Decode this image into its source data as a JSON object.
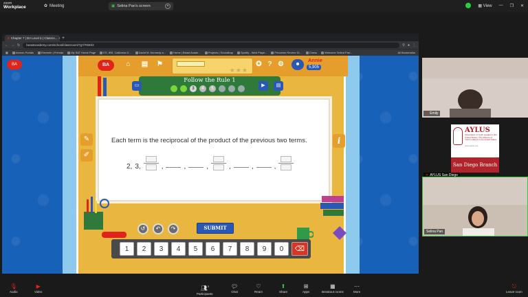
{
  "zoom": {
    "app_name": "zoom",
    "app_sub": "Workplace",
    "meeting_label": "Meeting",
    "share_label": "Selina Pan's screen",
    "view_label": "View",
    "colors": {
      "bg": "#1a1a1a",
      "accent_green": "#2ecc40",
      "accent_red": "#e2231a"
    }
  },
  "browser": {
    "tab_title": "Chapter 7 | BA Level 5 | Classro...",
    "url": "beastacademy.com/school/classroom/7g7/7830/2",
    "bookmarks": [
      "Aemon Portals",
      "Eleventh | Friends",
      "My SAT Home Page",
      "ES, IBS, California D...",
      "David M. Kennedy a...",
      "Home | Beast Acade...",
      "Projects | Soundtrap",
      "Spotify - Web Playe...",
      "Princeton Review Di...",
      "Chess",
      "Welcome Selina Pan..."
    ],
    "all_bookmarks": "All Bookmarks"
  },
  "game": {
    "logo_text": "BA",
    "user_name": "Annie",
    "user_score": "5,905",
    "lesson_title": "Follow the Rule 1",
    "instruction": "Each term is the reciprocal of the product of the previous two terms.",
    "sequence_start": [
      "2,",
      "3,"
    ],
    "submit_label": "SUBMIT",
    "keypad": [
      "1",
      "2",
      "3",
      "4",
      "5",
      "6",
      "7",
      "8",
      "9",
      "0"
    ],
    "info_label": "i",
    "level_dots": [
      "",
      "",
      "3",
      "4",
      "5",
      "",
      "",
      ""
    ],
    "progress_fraction": 0.35,
    "colors": {
      "board": "#e9b640",
      "side": "#1761b8",
      "header": "#e59d2c",
      "lesson_bar": "#2f7a3a",
      "submit": "#2a58b4"
    }
  },
  "participants": [
    {
      "name": "Emily"
    },
    {
      "name": "AYLUS San Diego",
      "card_title": "AYLUS",
      "card_sub": "Association of Youth Leaders in the United States / The Alliance of Youth Leaders in the United States",
      "card_url": "www.aylus.org",
      "card_branch": "San Diego Branch"
    },
    {
      "name": "Selina Pan"
    }
  ],
  "toolbar": {
    "audio": "Audio",
    "video": "Video",
    "participants": "Participants",
    "participants_count": "3",
    "chat": "Chat",
    "react": "React",
    "share": "Share",
    "apps": "Apps",
    "breakout": "Breakout rooms",
    "more": "More",
    "leave": "Leave room"
  }
}
